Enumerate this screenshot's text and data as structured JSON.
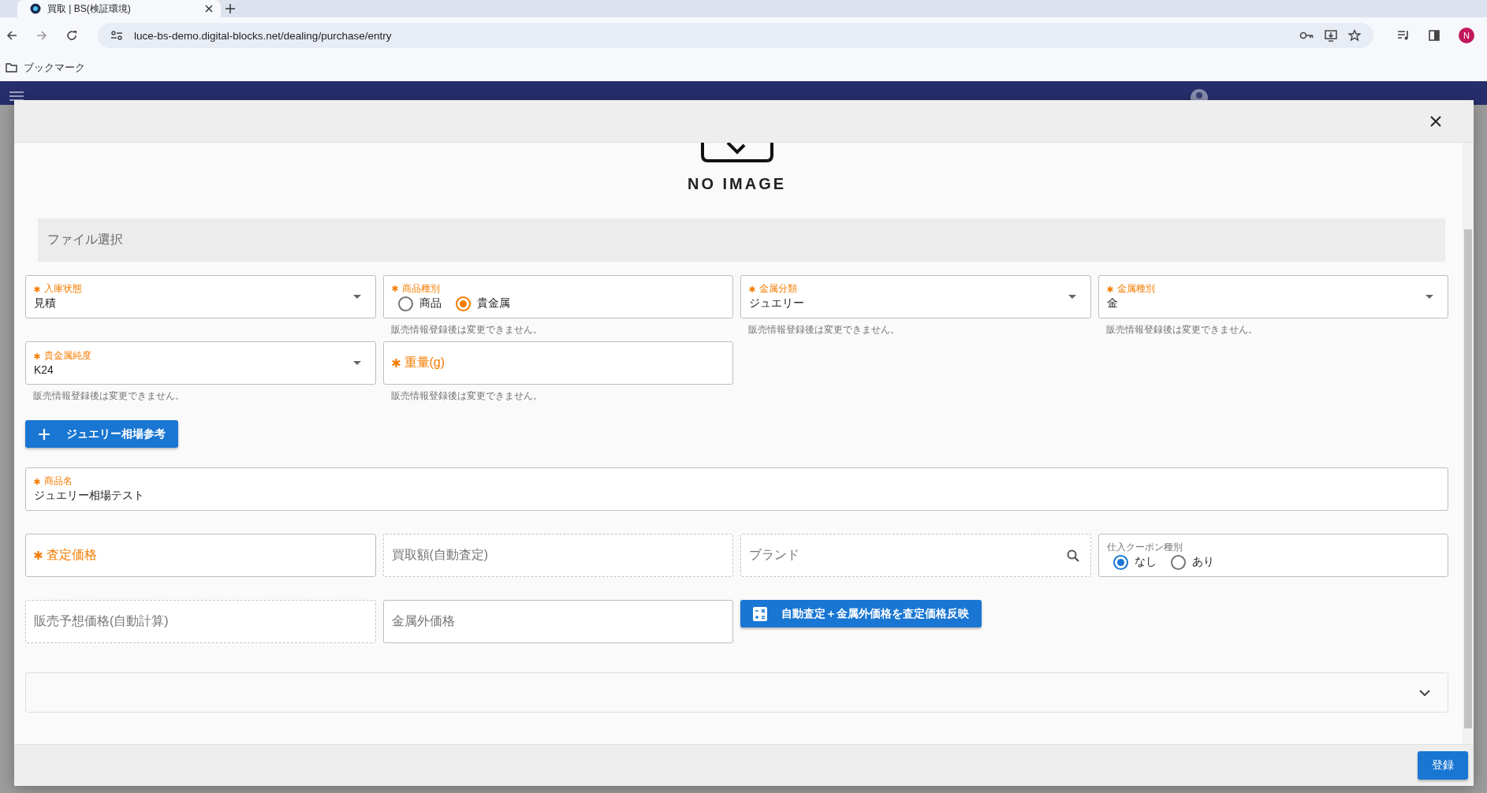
{
  "browser": {
    "tab_title": "買取 | BS(検証環境)",
    "url": "luce-bs-demo.digital-blocks.net/dealing/purchase/entry",
    "bookmarks_label": "ブックマーク",
    "profile_initial": "N"
  },
  "dialog": {
    "image_placeholder": "NO IMAGE",
    "file_select": "ファイル選択",
    "rows": [
      {
        "items": [
          {
            "kind": "select",
            "label": "入庫状態",
            "required": true,
            "value": "見積",
            "disabled": false
          },
          {
            "kind": "radio",
            "label": "商品種別",
            "required": true,
            "disabled": false,
            "options": [
              {
                "label": "商品",
                "selected": false
              },
              {
                "label": "貴金属",
                "selected": true
              }
            ],
            "hint": "販売情報登録後は変更できません。"
          },
          {
            "kind": "select",
            "label": "金属分類",
            "required": true,
            "value": "ジュエリー",
            "disabled": false,
            "hint": "販売情報登録後は変更できません。"
          },
          {
            "kind": "select",
            "label": "金属種別",
            "required": true,
            "value": "金",
            "disabled": false,
            "hint": "販売情報登録後は変更できません。"
          }
        ]
      },
      {
        "items": [
          {
            "kind": "select",
            "label": "貴金属純度",
            "required": true,
            "value": "K24",
            "disabled": false,
            "hint": "販売情報登録後は変更できません。"
          },
          {
            "kind": "text",
            "label": "重量(g)",
            "required": true,
            "disabled": false,
            "hint": "販売情報登録後は変更できません。"
          }
        ]
      },
      {
        "items": [
          {
            "kind": "add",
            "label": "ジュエリー相場参考"
          }
        ]
      },
      {
        "full": true,
        "items": [
          {
            "kind": "text",
            "label": "商品名",
            "required": true,
            "value": "ジュエリー相場テスト",
            "disabled": false
          }
        ]
      },
      {
        "items": [
          {
            "kind": "text",
            "label": "査定価格",
            "required": true,
            "disabled": false
          },
          {
            "kind": "text",
            "label": "買取額(自動査定)",
            "required": false,
            "disabled": true
          },
          {
            "kind": "search",
            "label": "ブランド",
            "required": false,
            "disabled": true
          },
          {
            "kind": "radio",
            "label": "仕入クーポン種別",
            "required": false,
            "disabled": false,
            "options": [
              {
                "label": "なし",
                "selected": true
              },
              {
                "label": "あり",
                "selected": false
              }
            ]
          }
        ]
      },
      {
        "items": [
          {
            "kind": "text",
            "label": "販売予想価格(自動計算)",
            "required": false,
            "disabled": true
          },
          {
            "kind": "text",
            "label": "金属外価格",
            "required": false,
            "disabled": false
          },
          {
            "kind": "apply",
            "label": "自動査定＋金属外価格を査定価格反映"
          }
        ]
      }
    ],
    "submit": "登録"
  }
}
